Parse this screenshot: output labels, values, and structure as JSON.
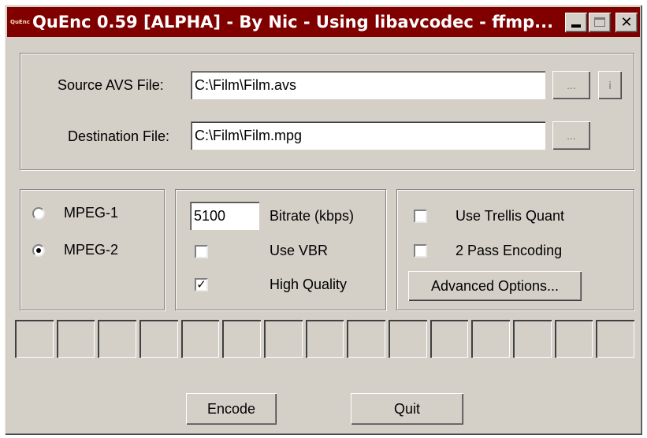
{
  "window": {
    "title": "QuEnc 0.59 [ALPHA] - By Nic - Using libavcodec - ffmp...",
    "icon_text": "QuEnc",
    "title_bar_color": "#800000"
  },
  "files": {
    "source_label": "Source AVS File:",
    "source_value": "C:\\Film\\Film.avs",
    "destination_label": "Destination File:",
    "destination_value": "C:\\Film\\Film.mpg",
    "browse_label": "...",
    "info_label": "i"
  },
  "format": {
    "options": [
      {
        "label": "MPEG-1",
        "selected": false
      },
      {
        "label": "MPEG-2",
        "selected": true
      }
    ]
  },
  "encoding": {
    "bitrate_value": "5100",
    "bitrate_label": "Bitrate (kbps)",
    "vbr_label": "Use VBR",
    "vbr_checked": false,
    "hq_label": "High Quality",
    "hq_checked": true
  },
  "advanced": {
    "trellis_label": "Use Trellis Quant",
    "trellis_checked": false,
    "two_pass_label": "2 Pass Encoding",
    "two_pass_checked": false,
    "advanced_button": "Advanced Options..."
  },
  "progress": {
    "segments": 15,
    "filled": 0
  },
  "actions": {
    "encode_label": "Encode",
    "quit_label": "Quit"
  },
  "colors": {
    "face": "#d4d0c8",
    "title_bar": "#800000"
  },
  "icons": [
    "minimize-icon",
    "maximize-icon",
    "close-icon"
  ]
}
